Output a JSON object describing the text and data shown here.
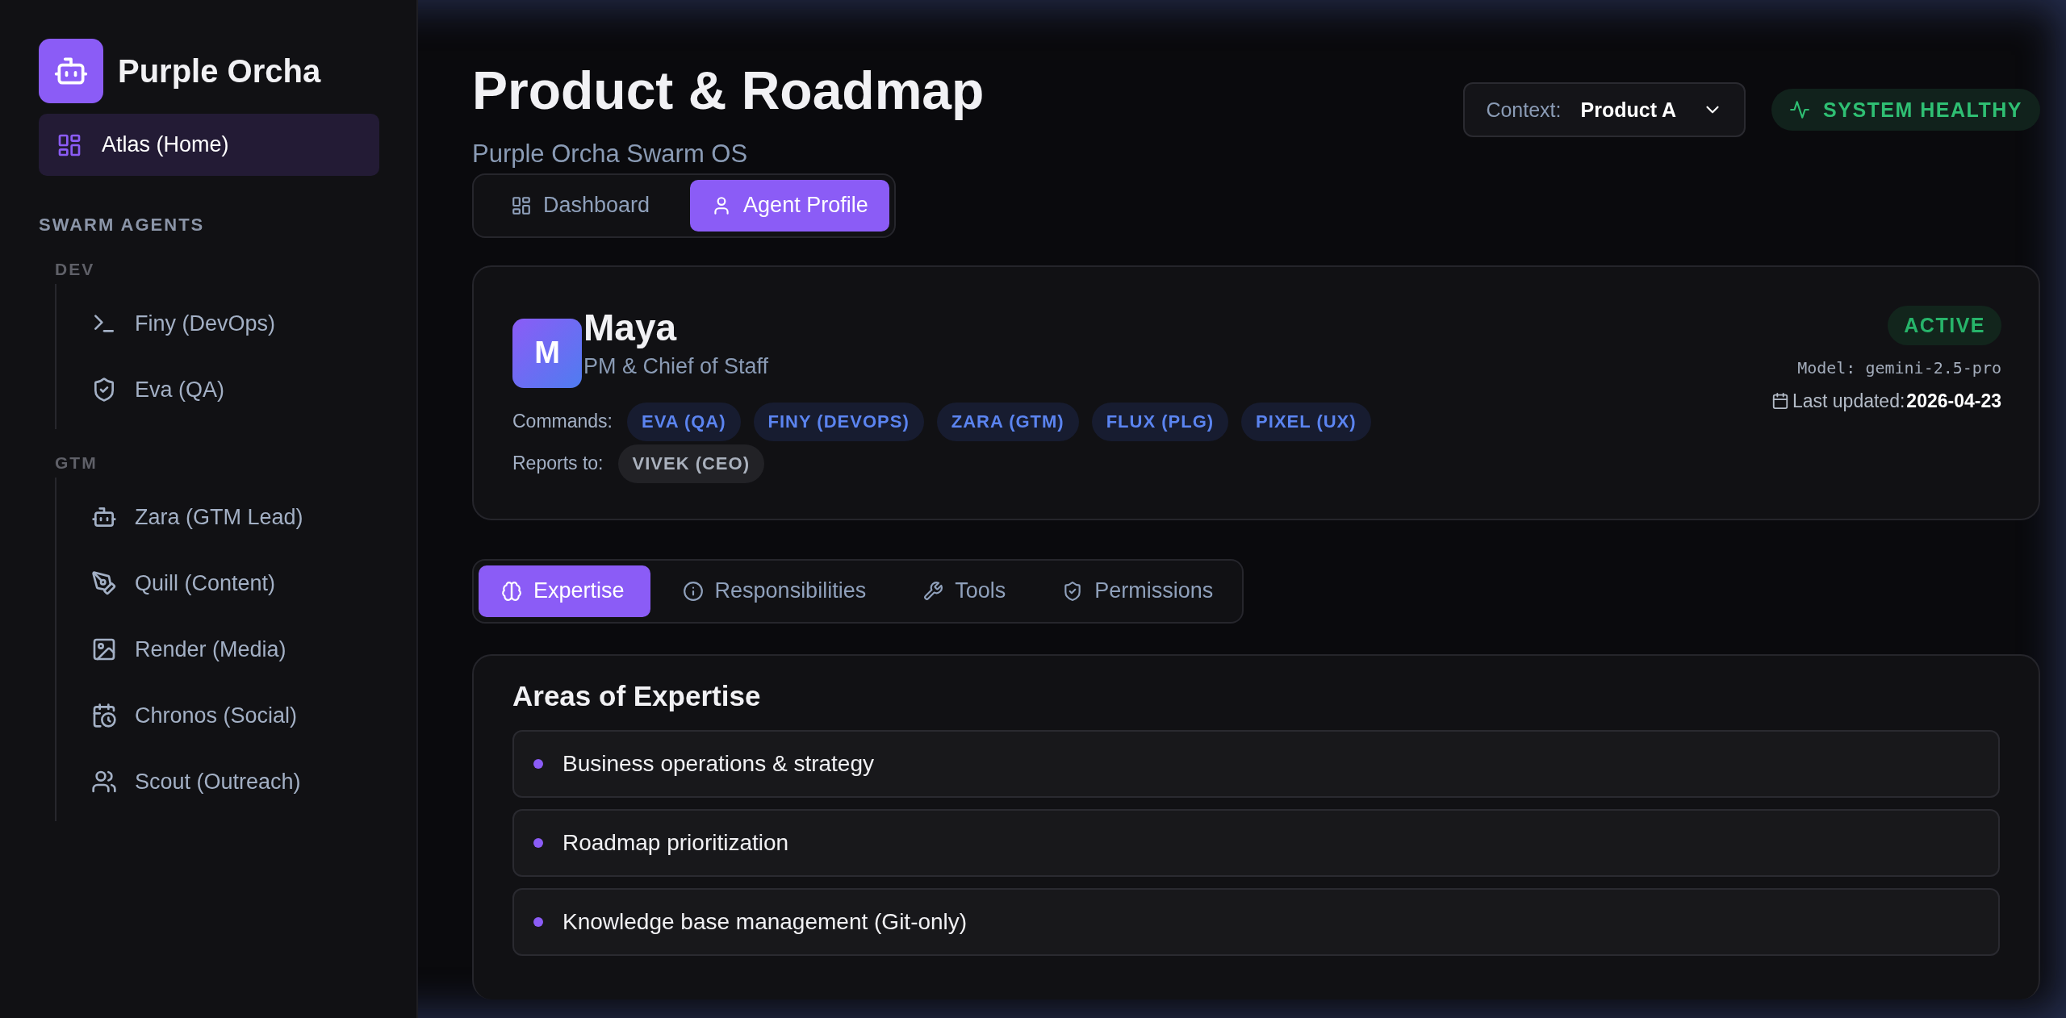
{
  "sidebar": {
    "brand": "Purple Orcha",
    "home": {
      "label": "Atlas (Home)",
      "selected": true
    },
    "section_title": "SWARM AGENTS",
    "groups": [
      {
        "label": "DEV",
        "items": [
          {
            "label": "Finy (DevOps)",
            "selected": false
          },
          {
            "label": "Eva (QA)",
            "selected": false
          }
        ]
      },
      {
        "label": "GTM",
        "items": [
          {
            "label": "Zara (GTM Lead)",
            "selected": false
          },
          {
            "label": "Quill (Content)",
            "selected": false
          },
          {
            "label": "Render (Media)",
            "selected": false
          },
          {
            "label": "Chronos (Social)",
            "selected": false
          },
          {
            "label": "Scout (Outreach)",
            "selected": false
          }
        ]
      }
    ]
  },
  "header": {
    "title": "Product & Roadmap",
    "subtitle": "Purple Orcha Swarm OS",
    "context": {
      "label": "Context:",
      "value": "Product A"
    },
    "status": "SYSTEM HEALTHY"
  },
  "view_tabs": [
    {
      "label": "Dashboard",
      "selected": false
    },
    {
      "label": "Agent Profile",
      "selected": true
    }
  ],
  "agent": {
    "initial": "M",
    "name": "Maya",
    "role": "PM & Chief of Staff",
    "status": "ACTIVE",
    "model": "Model: gemini-2.5-pro",
    "updated_label": "Last updated:",
    "updated": "2026-04-23",
    "commands_label": "Commands:",
    "commands": [
      "EVA (QA)",
      "FINY (DEVOPS)",
      "ZARA (GTM)",
      "FLUX (PLG)",
      "PIXEL (UX)"
    ],
    "reports_label": "Reports to:",
    "reports_to": [
      "VIVEK (CEO)"
    ]
  },
  "detail_tabs": [
    {
      "label": "Expertise",
      "selected": true
    },
    {
      "label": "Responsibilities",
      "selected": false
    },
    {
      "label": "Tools",
      "selected": false
    },
    {
      "label": "Permissions",
      "selected": false
    }
  ],
  "expertise": {
    "title": "Areas of Expertise",
    "items": [
      "Business operations & strategy",
      "Roadmap prioritization",
      "Knowledge base management (Git-only)"
    ]
  }
}
